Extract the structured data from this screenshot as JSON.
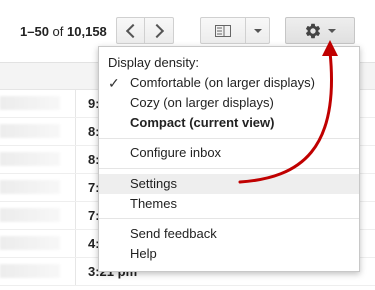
{
  "toolbar": {
    "range_text": "1–50",
    "of_text": "of",
    "total_text": "10,158",
    "prev_icon": "chevron-left-icon",
    "next_icon": "chevron-right-icon",
    "split_icon": "split-pane-icon",
    "settings_icon": "gear-icon"
  },
  "rows": [
    {
      "time": "9:"
    },
    {
      "time": "8:"
    },
    {
      "time": "8:"
    },
    {
      "time": "7:"
    },
    {
      "time": "7:"
    },
    {
      "time": "4:"
    },
    {
      "time": "3:21 pm"
    }
  ],
  "menu": {
    "header": "Display density:",
    "density": [
      {
        "label": "Comfortable (on larger displays)",
        "checked": true
      },
      {
        "label": "Cozy (on larger displays)",
        "checked": false
      },
      {
        "label": "Compact (current view)",
        "checked": false
      }
    ],
    "configure_inbox": "Configure inbox",
    "settings": "Settings",
    "themes": "Themes",
    "send_feedback": "Send feedback",
    "help": "Help",
    "check_glyph": "✓"
  },
  "colors": {
    "annotation_arrow": "#c00000",
    "hover_bg": "#eeeeee"
  }
}
